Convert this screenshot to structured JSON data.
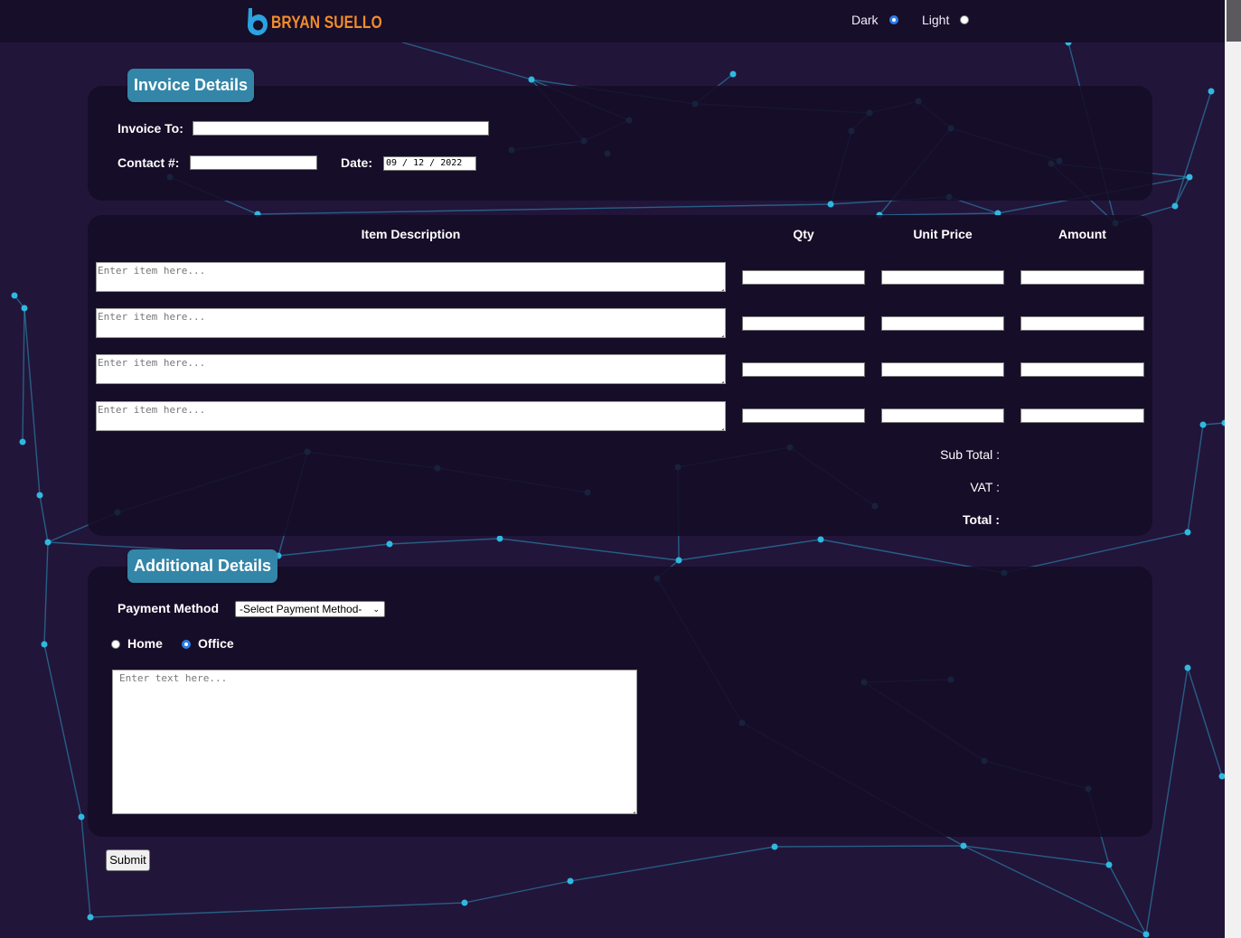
{
  "header": {
    "brand": "BRYAN SUELLO",
    "brand_color": "#f28c28",
    "logo_color": "#2aa3e0",
    "theme_options": [
      {
        "label": "Dark",
        "selected": true
      },
      {
        "label": "Light",
        "selected": false
      }
    ]
  },
  "invoice_details": {
    "title": "Invoice Details",
    "invoice_to_label": "Invoice To:",
    "invoice_to_value": "",
    "contact_label": "Contact #:",
    "contact_value": "",
    "date_label": "Date:",
    "date_value": "09 / 12 / 2022"
  },
  "items": {
    "headers": [
      "Item Description",
      "Qty",
      "Unit Price",
      "Amount"
    ],
    "placeholder": "Enter item here...",
    "rows": [
      {
        "description": "",
        "qty": "",
        "unit_price": "",
        "amount": ""
      },
      {
        "description": "",
        "qty": "",
        "unit_price": "",
        "amount": ""
      },
      {
        "description": "",
        "qty": "",
        "unit_price": "",
        "amount": ""
      },
      {
        "description": "",
        "qty": "",
        "unit_price": "",
        "amount": ""
      }
    ],
    "sub_total_label": "Sub Total :",
    "vat_label": "VAT :",
    "total_label": "Total :"
  },
  "additional_details": {
    "title": "Additional Details",
    "payment_label": "Payment Method",
    "payment_selected": "-Select Payment Method-",
    "address_options": [
      {
        "label": "Home",
        "selected": false
      },
      {
        "label": "Office",
        "selected": true
      }
    ],
    "notes_placeholder": "Enter text here..."
  },
  "submit_label": "Submit",
  "colors": {
    "background": "#22153a",
    "topbar": "#170e2a",
    "card": "#140c26",
    "section_tag": "#3386a8",
    "network_line": "#2fb9e0",
    "radio_selected": "#2b7de9"
  }
}
